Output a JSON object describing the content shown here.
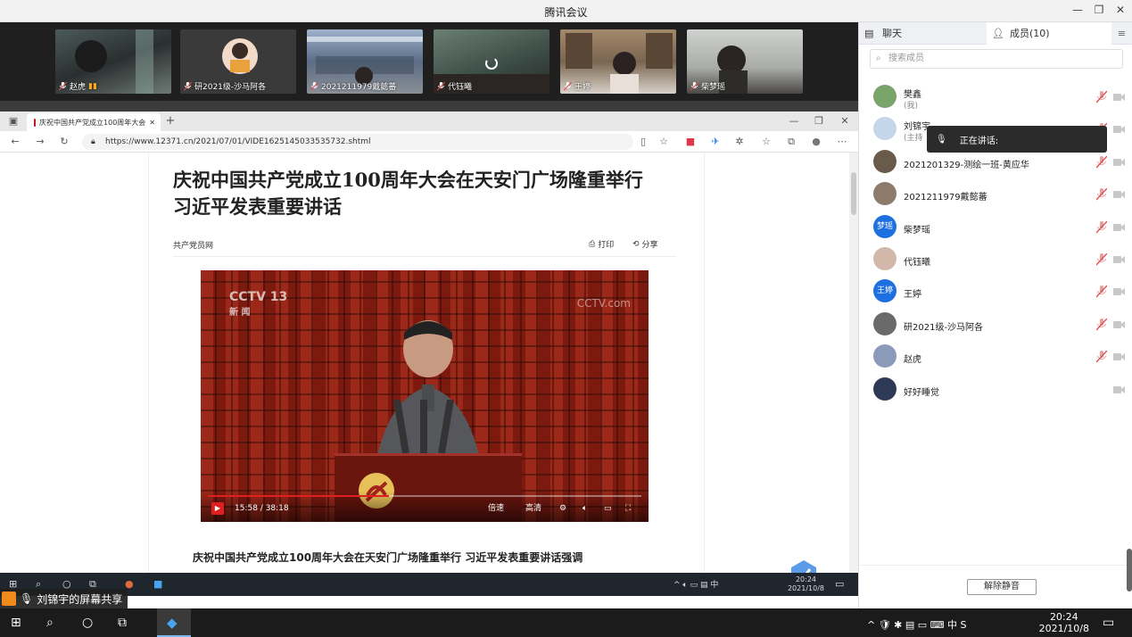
{
  "app": {
    "title": "腾讯会议"
  },
  "participants_strip": [
    {
      "name": "赵虎"
    },
    {
      "name": "研2021级-沙马阿各"
    },
    {
      "name": "2021211979戴懿蕃"
    },
    {
      "name": "代钰曦"
    },
    {
      "name": "王婷"
    },
    {
      "name": "柴梦瑶"
    }
  ],
  "browser": {
    "tab_title": "庆祝中国共产党成立100周年大会",
    "url": "https://www.12371.cn/2021/07/01/VIDE1625145033535732.shtml"
  },
  "article": {
    "headline_line1": "庆祝中国共产党成立100周年大会在天安门广场隆重举行",
    "headline_line2": "习近平发表重要讲话",
    "source": "共产党员网",
    "print_label": "打印",
    "share_label": "分享",
    "video": {
      "time": "15:58 / 38:18",
      "progress": 0.417,
      "speed_label": "倍速",
      "quality_label": "高清",
      "watermark_left": "CCTV 13",
      "watermark_left2": "新 闻",
      "watermark_right": "CCTV.com"
    },
    "subheadline": "庆祝中国共产党成立100周年大会在天安门广场隆重举行 习近平发表重要讲话强调"
  },
  "inner_taskbar": {
    "time": "20:24",
    "date": "2021/10/8"
  },
  "share_notice": "刘锦宇的屏幕共享",
  "taskbar": {
    "time": "20:24",
    "date": "2021/10/8"
  },
  "panel": {
    "chat_tab": "聊天",
    "members_tab": "成员(10)",
    "search_placeholder": "搜索成员",
    "speaking_label": "正在讲话:",
    "unmute_button": "解除静音",
    "members": [
      {
        "name": "樊鑫",
        "sub": "(我)"
      },
      {
        "name": "刘锦宇",
        "sub": "(主持"
      },
      {
        "name": "2021201329-测绘一班-黄应华"
      },
      {
        "name": "2021211979戴懿蕃"
      },
      {
        "name": "柴梦瑶",
        "avatar_text": "梦瑶"
      },
      {
        "name": "代钰曦"
      },
      {
        "name": "王婷",
        "avatar_text": "王婷"
      },
      {
        "name": "研2021级-沙马阿各"
      },
      {
        "name": "赵虎"
      },
      {
        "name": "好好睡觉"
      }
    ]
  },
  "colors": {
    "accent": "#1e6fe0",
    "muted_red": "#e24a4a",
    "video_red": "#8a1d14"
  }
}
